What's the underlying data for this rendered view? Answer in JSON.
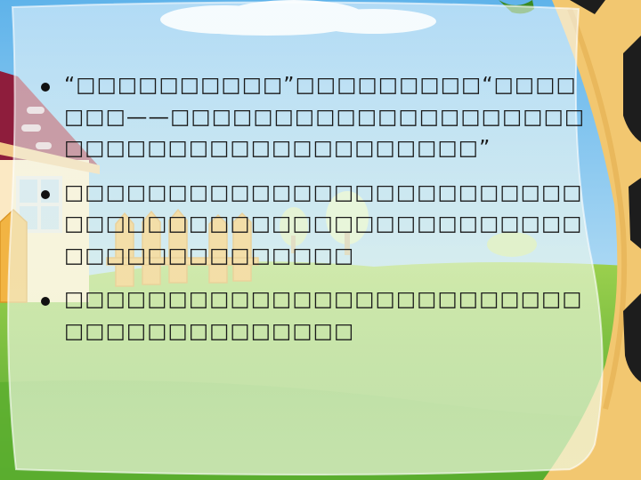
{
  "slide": {
    "bullets": [
      {
        "text": "“□□□□□□□□□□”□□□□□□□□□“□□□□□□□——□□□□□□□□□□□□□□□□□□□□□□□□□□□□□□□□□□□□□□□□”"
      },
      {
        "text": "□□□□□□□□□□□□□□□□□□□□□□□□□□□□□□□□□□□□□□□□□□□□□□□□□□□□□□□□□□□□□□□□"
      },
      {
        "text": "□□□□□□□□□□□□□□□□□□□□□□□□□□□□□□□□□□□□□□□"
      }
    ]
  },
  "colors": {
    "sky_top": "#5fb3ea",
    "sky_bottom": "#dff2fb",
    "grass": "#67b83a",
    "grass_light": "#d9ecaa",
    "trunk": "#f0c66a",
    "house_roof": "#8e1d3c",
    "fence": "#f2b443",
    "panel": "#f1f8ea"
  }
}
